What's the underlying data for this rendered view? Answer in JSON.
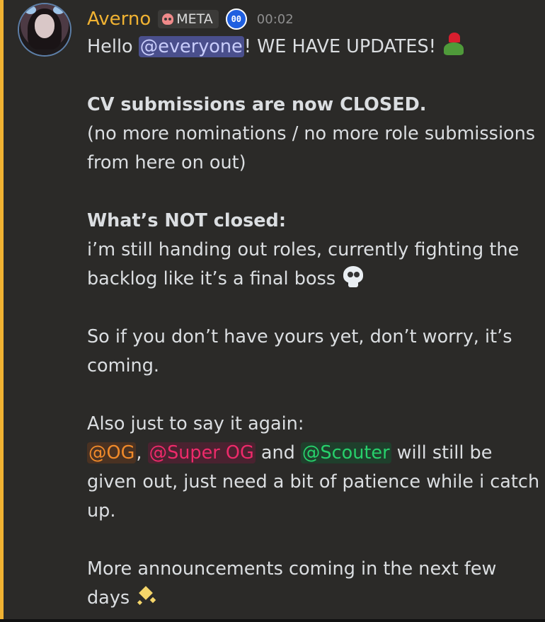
{
  "message": {
    "author": "Averno",
    "role_tag": "META",
    "badge_text": "00",
    "timestamp": "00:02",
    "accent_color": "#f0b232",
    "lines": {
      "l1_pre": "Hello ",
      "l1_mention": "@everyone",
      "l1_post": "! WE HAVE UPDATES!",
      "l2": "CV submissions are now CLOSED.",
      "l3": "(no more nominations / no more role submissions",
      "l4": "from here on out)",
      "l5": "What’s NOT closed:",
      "l6": "i’m still handing out roles, currently fighting the",
      "l7": "backlog like it’s a final boss",
      "l8": "So if you don’t have yours yet, don’t worry, it’s",
      "l9": "coming.",
      "l10": "Also just to say it again:",
      "l11_m1": "@OG",
      "l11_sep1": ", ",
      "l11_m2": "@Super OG",
      "l11_sep2": " and ",
      "l11_m3": "@Scouter",
      "l11_post": " will still be",
      "l12": "given out, just need a bit of patience while i catch",
      "l13": "up.",
      "l14": "More announcements coming in the next few",
      "l15": "days"
    },
    "emojis": {
      "updates": "heart-on-head-emoji",
      "boss": "skull-emoji",
      "days": "sparkles-emoji"
    }
  }
}
